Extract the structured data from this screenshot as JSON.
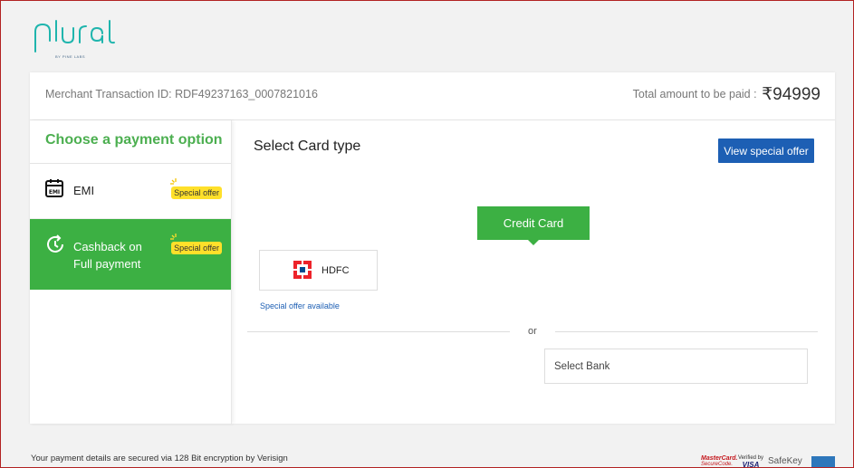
{
  "brand": {
    "logo_text": "plural",
    "logo_byline": "BY PINE LABS",
    "accent": "#1fb5ad"
  },
  "header": {
    "transaction_label": "Merchant Transaction ID: RDF49237163_0007821016",
    "total_label": "Total amount to be paid :",
    "total_amount": "₹94999"
  },
  "sidebar": {
    "title": "Choose a payment option",
    "options": [
      {
        "label": "EMI",
        "icon": "calendar-emi-icon",
        "badge": "Special offer",
        "active": false
      },
      {
        "label_line1": "Cashback on",
        "label_line2": "Full payment",
        "icon": "clock-refresh-icon",
        "badge": "Special offer",
        "active": true
      }
    ]
  },
  "main": {
    "title": "Select Card type",
    "special_offer_button": "View special offer",
    "card_type_button": "Credit Card",
    "bank_card": {
      "name": "HDFC",
      "icon": "hdfc-logo-icon"
    },
    "offer_link": "Special offer available",
    "or_text": "or",
    "bank_select_value": "Select Bank"
  },
  "footer": {
    "security_text": "Your payment details are secured via 128 Bit encryption by Verisign",
    "logos": [
      "MasterCard SecureCode",
      "Verified by VISA",
      "SafeKey",
      "American Express"
    ]
  },
  "colors": {
    "green": "#3cb043",
    "blue": "#1d5fb4",
    "badge": "#ffe02a",
    "border": "#b22222"
  }
}
